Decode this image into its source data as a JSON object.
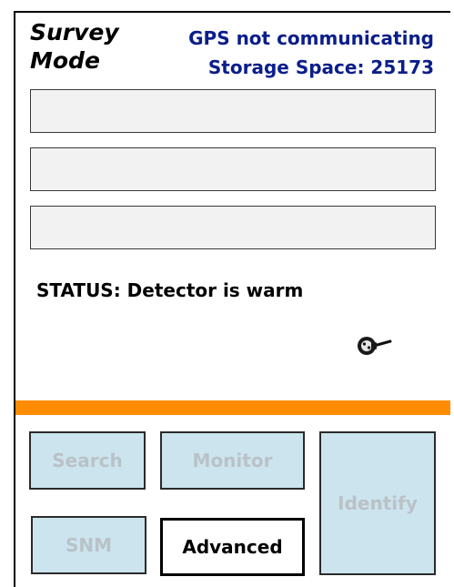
{
  "header": {
    "mode_title_line1": "Survey",
    "mode_title_line2": "Mode",
    "gps_status": "GPS not communicating",
    "storage_space": "Storage Space: 25173"
  },
  "fields": [
    "",
    "",
    ""
  ],
  "status": {
    "text": "STATUS: Detector is warm"
  },
  "indicators": {
    "power_icon": "power-plug-icon"
  },
  "colors": {
    "header_text": "#0b1e8a",
    "divider": "#ff8c00",
    "button_fill": "#cce4ee",
    "button_text_disabled": "#b9c2c7"
  },
  "buttons": {
    "search": {
      "label": "Search",
      "enabled": false
    },
    "monitor": {
      "label": "Monitor",
      "enabled": false
    },
    "identify": {
      "label": "Identify",
      "enabled": false
    },
    "snm": {
      "label": "SNM",
      "enabled": false
    },
    "advanced": {
      "label": "Advanced",
      "enabled": true
    }
  }
}
